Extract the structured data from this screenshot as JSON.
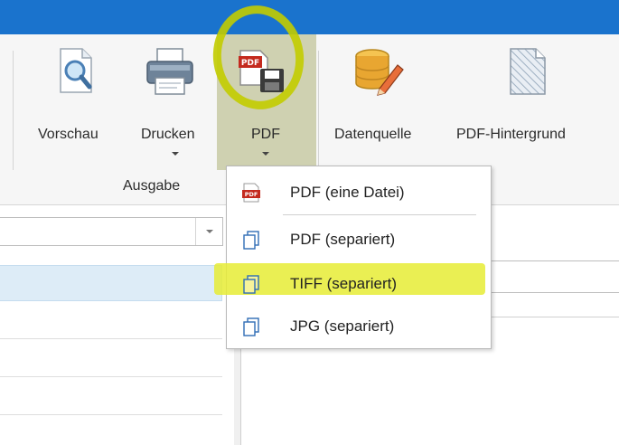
{
  "ribbon": {
    "buttons": [
      {
        "label": "Vorschau",
        "icon": "magnifier-document-icon",
        "has_dropdown": false
      },
      {
        "label": "Drucken",
        "icon": "printer-icon",
        "has_dropdown": true
      },
      {
        "label": "PDF",
        "icon": "pdf-save-icon",
        "has_dropdown": true,
        "pressed": true
      },
      {
        "label": "Datenquelle",
        "icon": "database-pencil-icon",
        "has_dropdown": false
      },
      {
        "label": "PDF-Hintergrund",
        "icon": "background-page-icon",
        "has_dropdown": false
      }
    ],
    "group_label": "Ausgabe"
  },
  "pdf_menu": {
    "items": [
      {
        "label": "PDF (eine Datei)",
        "icon": "pdf-icon",
        "highlighted": false
      },
      {
        "label": "PDF (separiert)",
        "icon": "pages-icon",
        "highlighted": false
      },
      {
        "label": "TIFF (separiert)",
        "icon": "pages-icon",
        "highlighted": true
      },
      {
        "label": "JPG (separiert)",
        "icon": "pages-icon",
        "highlighted": false
      }
    ]
  },
  "colors": {
    "titlebar": "#1a73cd",
    "ribbon_bg": "#f6f6f6",
    "pressed_button": "#cfd1b1",
    "annotation_highlight": "#e6ec35",
    "selected_row": "#ddecf7"
  }
}
